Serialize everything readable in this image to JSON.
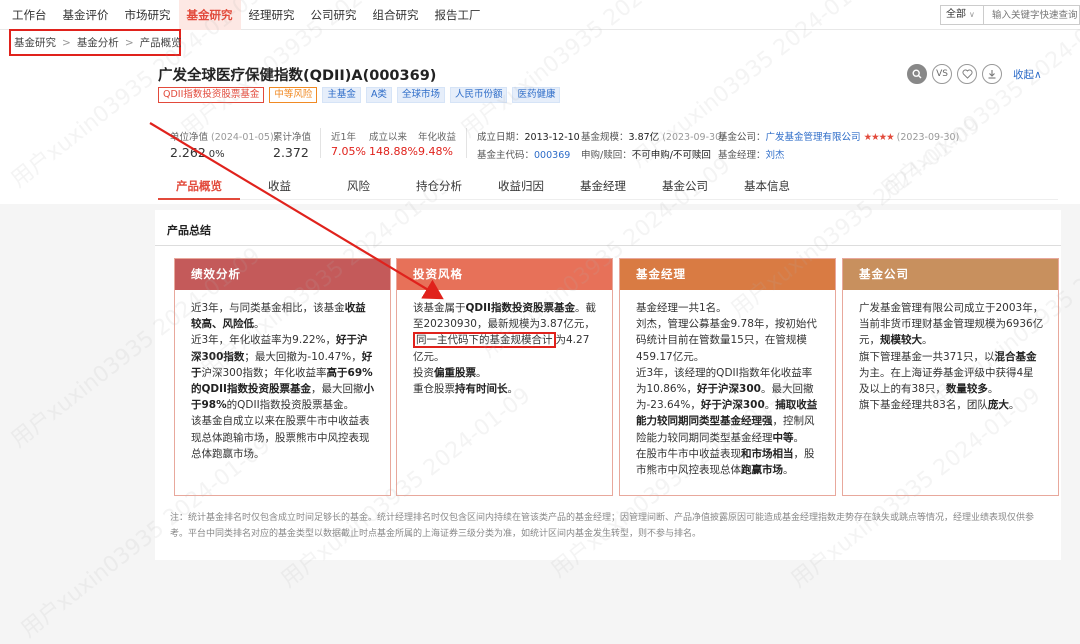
{
  "topnav": {
    "items": [
      {
        "label": "工作台",
        "active": false,
        "w": 40
      },
      {
        "label": "基金评价",
        "active": false,
        "w": 60
      },
      {
        "label": "市场研究",
        "active": false,
        "w": 57
      },
      {
        "label": "基金研究",
        "active": true,
        "w": 59
      },
      {
        "label": "经理研究",
        "active": false,
        "w": 60
      },
      {
        "label": "公司研究",
        "active": false,
        "w": 60
      },
      {
        "label": "组合研究",
        "active": false,
        "w": 60
      },
      {
        "label": "报告工厂",
        "active": false,
        "w": 60
      }
    ],
    "scope_select": "全部",
    "search_placeholder": "输入关键字快速查询"
  },
  "breadcrumb": [
    "基金研究",
    "基金分析",
    "产品概览"
  ],
  "fund": {
    "title": "广发全球医疗保健指数(QDII)A(000369)",
    "tags": [
      {
        "label": "QDII指数投资股票基金",
        "style": "red"
      },
      {
        "label": "中等风险",
        "style": "orange"
      },
      {
        "label": "主基金",
        "style": "blue"
      },
      {
        "label": "A类",
        "style": "blue"
      },
      {
        "label": "全球市场",
        "style": "blue"
      },
      {
        "label": "人民币份额",
        "style": "blue"
      },
      {
        "label": "医药健康",
        "style": "blue"
      }
    ],
    "actions": {
      "vs": "VS",
      "collapse": "收起∧"
    },
    "metrics": {
      "nav_label": "单位净值",
      "nav_date": "(2024-01-05)",
      "nav_value": "2.262",
      "nav_change": "0%",
      "cum_nav_label": "累计净值",
      "cum_nav_value": "2.372",
      "ret_1y_label": "近1年",
      "ret_1y_value": "7.05%",
      "ret_inception_label": "成立以来",
      "ret_inception_value": "148.88%",
      "ann_label": "年化收益",
      "ann_value": "9.48%"
    },
    "info": {
      "inception_label": "成立日期：",
      "inception_value": "2013-12-10",
      "scale_label": "基金规模：",
      "scale_value": "3.87亿",
      "scale_date": "(2023-09-30)",
      "company_label": "基金公司：",
      "company_value": "广发基金管理有限公司",
      "company_stars": "★★★★",
      "company_date": "(2023-09-30)",
      "code_label": "基金主代码：",
      "code_value": "000369",
      "subscribe_label": "申购/赎回：",
      "subscribe_value": "不可申购/不可赎回",
      "manager_label": "基金经理：",
      "manager_value": "刘杰"
    }
  },
  "tabs": [
    "产品概览",
    "收益",
    "风险",
    "持仓分析",
    "收益归因",
    "基金经理",
    "基金公司",
    "基本信息"
  ],
  "summary": {
    "title": "产品总结",
    "cards": [
      {
        "title": "绩效分析",
        "color": "#c45a5a",
        "html": "近3年，与同类基金相比，该基金<b>收益较高、风险低</b>。<br>近3年，年化收益率为9.22%，<b>好于沪深300指数</b>；最大回撤为-10.47%，<b>好于</b>沪深300指数；年化收益率<b>高于69%的QDII指数投资股票基金</b>，最大回撤<b>小于98%</b>的QDII指数投资股票基金。<br>该基金自成立以来在股票牛市中收益表现总体跑输市场，股票熊市中风控表现总体跑赢市场。"
      },
      {
        "title": "投资风格",
        "color": "#e77159",
        "html": "该基金属于<b>QDII指数投资股票基金</b>。截至20230930，最新规模为3.87亿元，<span class=\"hl\">同一主代码下的基金规模合计</span>为4.27亿元。<br>投资<b>偏重股票</b>。<br>重仓股票<b>持有时间长</b>。"
      },
      {
        "title": "基金经理",
        "color": "#d97b43",
        "html": "基金经理一共1名。<br>刘杰，管理公募基金9.78年，按初始代码统计目前在管数量15只，在管规模459.17亿元。<br>近3年，该经理的QDII指数年化收益率为10.86%，<b>好于沪深300</b>。最大回撤为-23.64%，<b>好于沪深300</b>。<b>捕取收益能力较同期同类型基金经理强</b>，控制风险能力较同期同类型基金经理<b>中等</b>。<br>在股市牛市中收益表现<b>和市场相当</b>，股市熊市中风控表现总体<b>跑赢市场</b>。"
      },
      {
        "title": "基金公司",
        "color": "#c8905e",
        "html": "广发基金管理有限公司成立于2003年，当前非货币理财基金管理规模为6936亿元，<b>规模较大</b>。<br>旗下管理基金一共371只，以<b>混合基金</b>为主。在上海证券基金评级中获得4星及以上的有38只，<b>数量较多</b>。<br>旗下基金经理共83名，团队<b>庞大</b>。"
      }
    ],
    "note": "注：统计基金排名时仅包含成立时间足够长的基金。统计经理排名时仅包含区间内持续在管该类产品的基金经理；因管理间断、产品净值披露原因可能造成基金经理指数走势存在缺失或跳点等情况，经理业绩表现仅供参考。平台中同类排名对应的基金类型以数据截止时点基金所属的上海证券三级分类为准，如统计区间内基金发生转型，则不参与排名。"
  },
  "watermark": "用户xuxin03935 2024-01-09"
}
